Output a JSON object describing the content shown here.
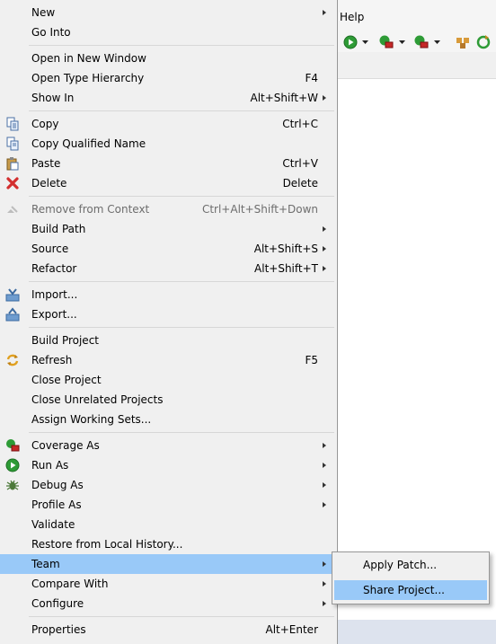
{
  "background": {
    "menubar_visible_item": "Help",
    "toolbar_icons": [
      "run-icon",
      "run-dropdown-icon",
      "coverage-icon",
      "coverage-dropdown-icon",
      "external-tools-icon",
      "external-tools-dropdown-icon",
      "package-icon",
      "refresh-icon"
    ]
  },
  "menu": {
    "items": [
      {
        "label": "New",
        "shortcut": "",
        "submenu": true
      },
      {
        "label": "Go Into",
        "shortcut": "",
        "submenu": false
      },
      {
        "label": "Open in New Window",
        "shortcut": "",
        "submenu": false
      },
      {
        "label": "Open Type Hierarchy",
        "shortcut": "F4",
        "submenu": false
      },
      {
        "label": "Show In",
        "shortcut": "Alt+Shift+W",
        "submenu": true
      },
      {
        "label": "Copy",
        "shortcut": "Ctrl+C",
        "icon": "copy-icon"
      },
      {
        "label": "Copy Qualified Name",
        "shortcut": "",
        "icon": "copy-qualified-name-icon"
      },
      {
        "label": "Paste",
        "shortcut": "Ctrl+V",
        "icon": "paste-icon"
      },
      {
        "label": "Delete",
        "shortcut": "Delete",
        "icon": "delete-icon"
      },
      {
        "label": "Remove from Context",
        "shortcut": "Ctrl+Alt+Shift+Down",
        "icon": "remove-context-icon",
        "disabled": true
      },
      {
        "label": "Build Path",
        "shortcut": "",
        "submenu": true
      },
      {
        "label": "Source",
        "shortcut": "Alt+Shift+S",
        "submenu": true
      },
      {
        "label": "Refactor",
        "shortcut": "Alt+Shift+T",
        "submenu": true
      },
      {
        "label": "Import...",
        "shortcut": "",
        "icon": "import-icon"
      },
      {
        "label": "Export...",
        "shortcut": "",
        "icon": "export-icon"
      },
      {
        "label": "Build Project",
        "shortcut": ""
      },
      {
        "label": "Refresh",
        "shortcut": "F5",
        "icon": "refresh-icon"
      },
      {
        "label": "Close Project",
        "shortcut": ""
      },
      {
        "label": "Close Unrelated Projects",
        "shortcut": ""
      },
      {
        "label": "Assign Working Sets...",
        "shortcut": ""
      },
      {
        "label": "Coverage As",
        "shortcut": "",
        "submenu": true,
        "icon": "coverage-icon"
      },
      {
        "label": "Run As",
        "shortcut": "",
        "submenu": true,
        "icon": "run-icon"
      },
      {
        "label": "Debug As",
        "shortcut": "",
        "submenu": true,
        "icon": "debug-icon"
      },
      {
        "label": "Profile As",
        "shortcut": "",
        "submenu": true
      },
      {
        "label": "Validate",
        "shortcut": ""
      },
      {
        "label": "Restore from Local History...",
        "shortcut": ""
      },
      {
        "label": "Team",
        "shortcut": "",
        "submenu": true,
        "highlighted": true
      },
      {
        "label": "Compare With",
        "shortcut": "",
        "submenu": true
      },
      {
        "label": "Configure",
        "shortcut": "",
        "submenu": true
      },
      {
        "label": "Properties",
        "shortcut": "Alt+Enter"
      }
    ]
  },
  "team_submenu": {
    "items": [
      {
        "label": "Apply Patch..."
      },
      {
        "label": "Share Project...",
        "highlighted": true
      }
    ]
  },
  "colors": {
    "menu_bg": "#f0f0f0",
    "highlight": "#99c9f8",
    "separator": "#d7d7d7",
    "disabled_text": "#6d6d6d"
  }
}
